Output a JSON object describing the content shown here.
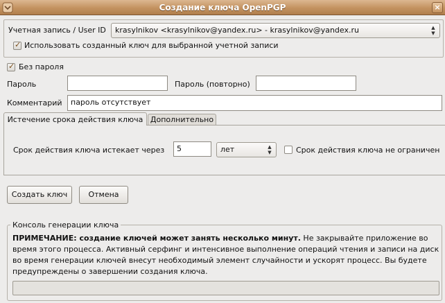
{
  "window": {
    "title": "Создание ключа OpenPGP",
    "close_glyph": "×"
  },
  "account": {
    "label": "Учетная запись / User ID",
    "selected": "krasylnikov <krasylnikov@yandex.ru> - krasylnikov@yandex.ru",
    "use_for_account_label": "Использовать созданный ключ для выбранной учетной записи",
    "use_for_account_checked": true
  },
  "passphrase": {
    "no_password_label": "Без пароля",
    "no_password_checked": true,
    "password_label": "Пароль",
    "password_value": "",
    "repeat_label": "Пароль (повторно)",
    "repeat_value": ""
  },
  "comment": {
    "label": "Комментарий",
    "value": "пароль отсутствует"
  },
  "tabs": [
    {
      "label": "Истечение срока действия ключа",
      "active": true
    },
    {
      "label": "Дополнительно",
      "active": false
    }
  ],
  "expiry": {
    "label": "Срок действия ключа истекает через",
    "amount": "5",
    "unit": "лет",
    "no_expiry_label": "Срок действия ключа не ограничен",
    "no_expiry_checked": false
  },
  "buttons": {
    "create": "Создать ключ",
    "cancel": "Отмена"
  },
  "console": {
    "title": "Консоль генерации ключа",
    "note_bold": "ПРИМЕЧАНИЕ: создание ключей может занять несколько минут.",
    "note_text": " Не закрывайте приложение во время этого процесса. Активный серфинг и интенсивное выполнение операций чтения и записи на диск во время генерации ключей внесут необходимый элемент случайности и ускорят процесс. Вы будете предупреждены о завершении создания ключа.",
    "progress": 0
  },
  "colors": {
    "titlebar": "#c39260",
    "check_mark": "#7a4d1b"
  }
}
